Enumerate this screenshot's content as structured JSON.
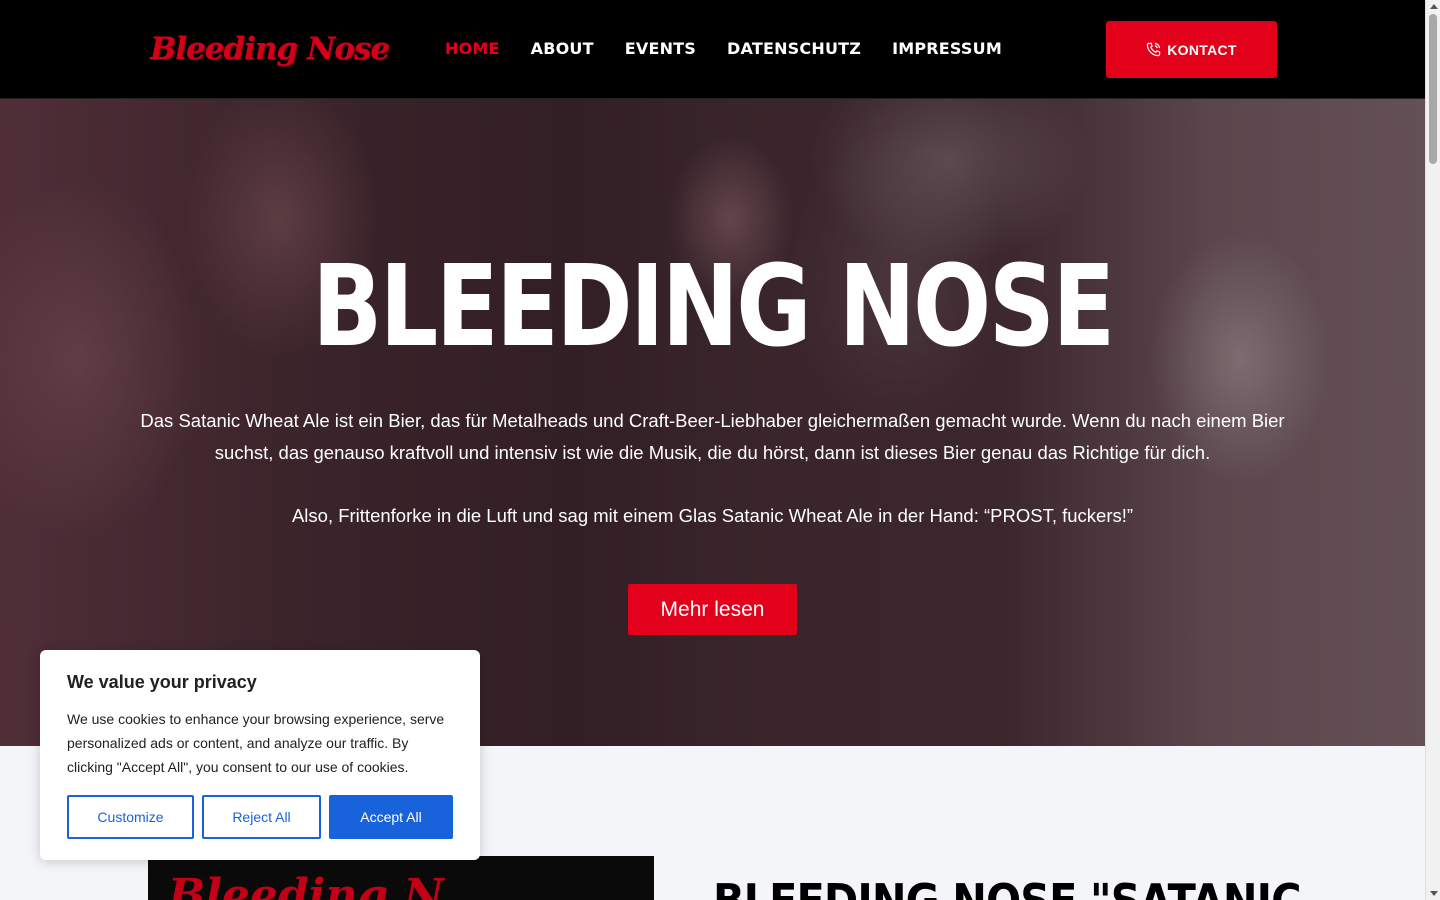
{
  "header": {
    "logo_text": "Bleeding Nose",
    "nav": [
      {
        "label": "HOME",
        "active": true
      },
      {
        "label": "ABOUT",
        "active": false
      },
      {
        "label": "EVENTS",
        "active": false
      },
      {
        "label": "DATENSCHUTZ",
        "active": false
      },
      {
        "label": "IMPRESSUM",
        "active": false
      }
    ],
    "contact_label": "KONTACT",
    "contact_icon": "phone-icon"
  },
  "hero": {
    "title": "BLEEDING NOSE",
    "paragraph1": "Das Satanic Wheat Ale ist ein Bier, das für Metalheads und Craft-Beer-Liebhaber gleichermaßen gemacht wurde. Wenn du nach einem Bier suchst, das genauso kraftvoll und intensiv ist wie die Musik, die du hörst, dann ist dieses Bier genau das Richtige für dich.",
    "paragraph2": "Also, Frittenforke in die Luft und sag mit einem Glas Satanic Wheat Ale in der Hand: “PROST, fuckers!”",
    "cta_label": "Mehr lesen"
  },
  "section2": {
    "image_text": "Bleeding N",
    "title": "BLEEDING NOSE \"SATANIC"
  },
  "cookie": {
    "title": "We value your privacy",
    "text": "We use cookies to enhance your browsing experience, serve personalized ads or content, and analyze our traffic. By clicking \"Accept All\", you consent to our use of cookies.",
    "customize_label": "Customize",
    "reject_label": "Reject All",
    "accept_label": "Accept All"
  },
  "colors": {
    "brand_red": "#e3001b",
    "header_bg": "#000000",
    "cookie_blue": "#1863dc"
  }
}
